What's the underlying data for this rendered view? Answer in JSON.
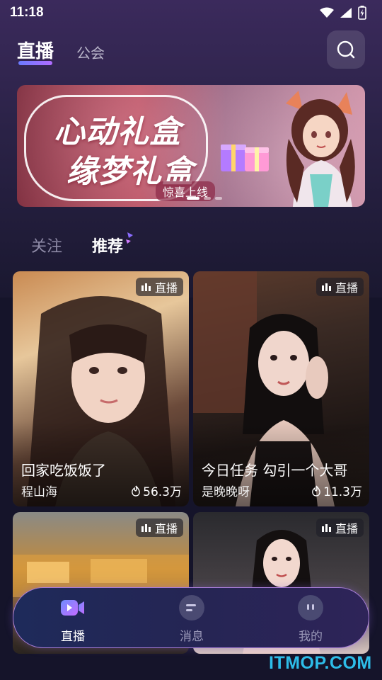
{
  "status_bar": {
    "time": "11:18"
  },
  "header": {
    "tab_live": "直播",
    "tab_guild": "公会",
    "search_icon": "search-icon"
  },
  "banner": {
    "title_line1": "心动礼盒",
    "title_line2": "缘梦礼盒",
    "subtitle": "惊喜上线"
  },
  "subtabs": {
    "follow": "关注",
    "recommend": "推荐"
  },
  "cards": [
    {
      "badge": "直播",
      "title": "回家吃饭饭了",
      "host": "程山海",
      "heat": "56.3万"
    },
    {
      "badge": "直播",
      "title": "今日任务 勾引一个大哥",
      "host": "是晚晚呀",
      "heat": "11.3万"
    },
    {
      "badge": "直播"
    },
    {
      "badge": "直播"
    }
  ],
  "bottom_nav": [
    {
      "label": "直播",
      "icon": "video-camera-icon"
    },
    {
      "label": "消息",
      "icon": "message-icon"
    },
    {
      "label": "我的",
      "icon": "profile-face-icon"
    }
  ],
  "watermark": "ITMOP.COM",
  "colors": {
    "accent": "#8a6cff",
    "nav_border": "#a57bd6",
    "watermark": "#2dbde9"
  }
}
